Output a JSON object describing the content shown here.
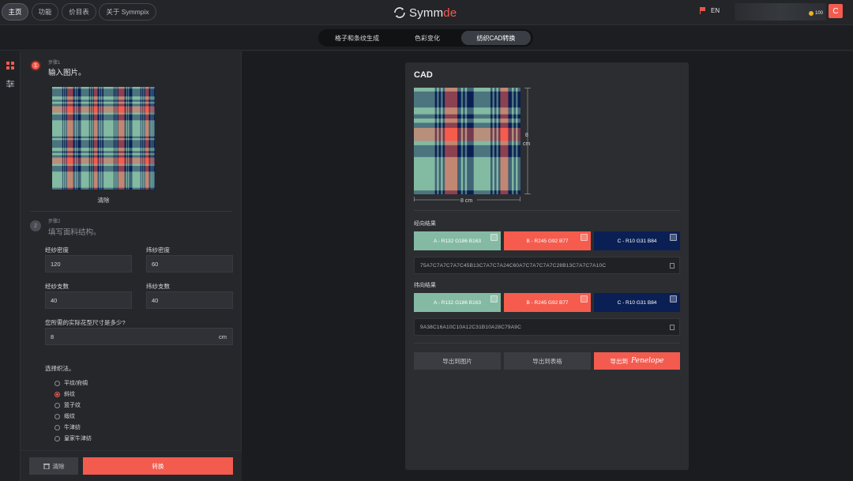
{
  "nav": {
    "home": "主页",
    "features": "功能",
    "pricing": "价目表",
    "about": "关于 Symmpix"
  },
  "brand": {
    "name_a": "Symm",
    "name_b": "de"
  },
  "lang": {
    "label": "EN"
  },
  "account": {
    "coins": "100",
    "avatar_letter": "C"
  },
  "tabs": [
    "格子和条纹生成",
    "色彩变化",
    "纺织CAD转换"
  ],
  "panel": {
    "step1": {
      "num": "1",
      "small": "步骤1",
      "title": "输入图片。",
      "clear_label": "清除"
    },
    "step2": {
      "num": "2",
      "small": "步骤2",
      "title": "填写面料结构。"
    },
    "warp_density": {
      "label": "经纱密度",
      "value": "120"
    },
    "weft_density": {
      "label": "纬纱密度",
      "value": "60"
    },
    "warp_count": {
      "label": "经纱支数",
      "value": "40"
    },
    "weft_count": {
      "label": "纬纱支数",
      "value": "40"
    },
    "pattern_size": {
      "label": "您所需的实际花型尺寸是多少?",
      "value": "8",
      "unit": "cm"
    },
    "weave": {
      "label": "选择织法。",
      "options": [
        "平纹/府绸",
        "斜纹",
        "篮子纹",
        "缎纹",
        "牛津纺",
        "皇家牛津纺"
      ],
      "selected": "斜纹"
    },
    "footer": {
      "clear": "清除",
      "convert": "转换"
    }
  },
  "card": {
    "title": "CAD",
    "dim_width": "8 cm",
    "dim_height_num": "8",
    "dim_height_unit": "cm",
    "warp": {
      "label": "经向结果",
      "swatches": [
        {
          "label": "A - R132 G186 B163",
          "color": "#84baa3",
          "text": "#ffffff"
        },
        {
          "label": "B - R245 G92 B77",
          "color": "#f55c4d",
          "text": "#ffffff"
        },
        {
          "label": "C - R10 G31 B84",
          "color": "#0a1f54",
          "text": "#ffffff"
        }
      ],
      "code": "75A7C7A7C7A7C45B13C7A7C7A24C60A7C7A7C7A7C28B13C7A7C7A10C"
    },
    "weft": {
      "label": "纬向结果",
      "swatches": [
        {
          "label": "A - R132 G186 B163",
          "color": "#84baa3",
          "text": "#ffffff"
        },
        {
          "label": "B - R245 G92 B77",
          "color": "#f55c4d",
          "text": "#ffffff"
        },
        {
          "label": "C - R10 G31 B84",
          "color": "#0a1f54",
          "text": "#ffffff"
        }
      ],
      "code": "9A38C16A10C10A12C31B10A28C79A9C"
    },
    "actions": {
      "export_image": "导出到图片",
      "export_table": "导出到表格",
      "export_penelope": "导出到",
      "penelope_brand": "Penelope"
    }
  },
  "colors": {
    "accent": "#f35b4f",
    "tartan_green": "#84baa3",
    "tartan_red": "#f55c4d",
    "tartan_navy": "#0a1f54"
  }
}
